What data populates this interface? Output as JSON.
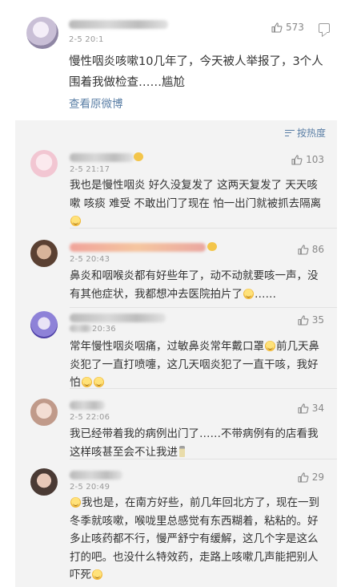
{
  "post": {
    "meta": "2-5 20:1",
    "likes": "573",
    "text": "慢性咽炎咳嗽10几年了，今天被人举报了，3个人围着我做检查……尴尬",
    "view_original": "查看原微博"
  },
  "sort": {
    "label": "按热度"
  },
  "comments": [
    {
      "meta": "2-5 21:17",
      "likes": "103",
      "text": "我也是慢性咽炎 好久没复发了 这两天复发了 天天咳嗽 咳痰 难受 不敢出门了现在 怕一出门就被抓去隔离"
    },
    {
      "meta": "2-5 20:43",
      "likes": "86",
      "text": "鼻炎和咽喉炎都有好些年了，动不动就要咳一声，没有其他症状，我都想冲去医院拍片了",
      "text_end": "……"
    },
    {
      "meta": "20:36",
      "likes": "35",
      "text_a": "常年慢性咽炎咽痛，过敏鼻炎常年戴口罩",
      "text_b": "前几天鼻炎犯了一直打喷嚏，这几天咽炎犯了一直干咳，我好怕"
    },
    {
      "meta": "2-5 22:06",
      "likes": "34",
      "text": "我已经带着我的病例出门了……不带病例有的店看我这样咳甚至会不让我进"
    },
    {
      "meta": "2-5 20:49",
      "likes": "29",
      "text": "我也是，在南方好些，前几年回北方了，现在一到冬季就咳嗽，喉咙里总感觉有东西糊着，粘粘的。好多止咳药都不行，慢严舒宁有缓解，这几个字是这么打的吧。也没什么特效药，走路上咳嗽几声能把别人吓死"
    }
  ],
  "colors": {
    "link": "#5b7fa6",
    "panel": "#f3f3f3",
    "meta": "#999999"
  }
}
